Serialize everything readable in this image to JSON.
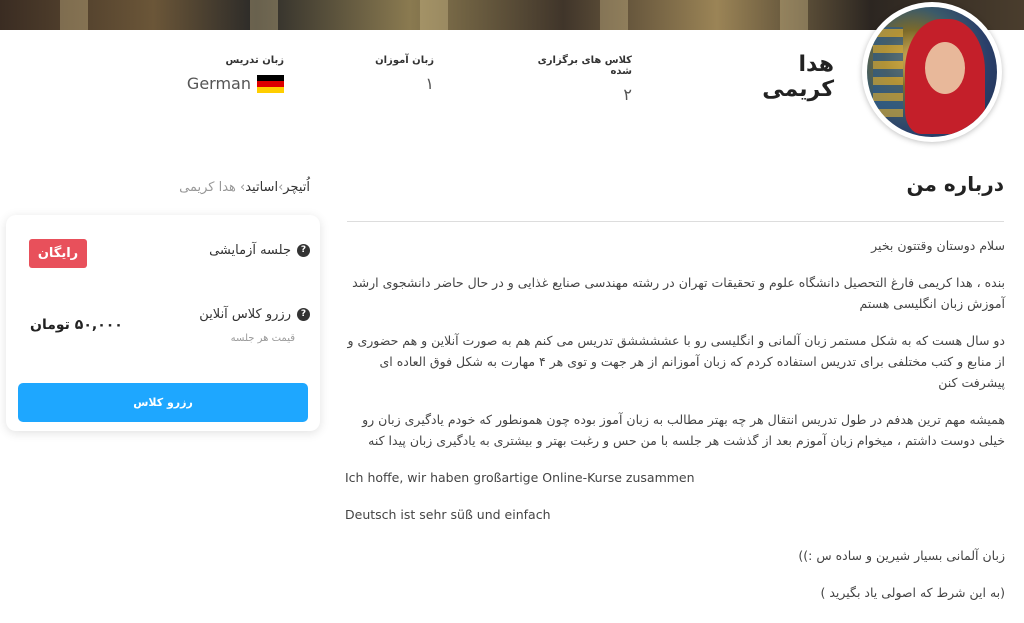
{
  "teacher": {
    "name": "هدا کریمی",
    "stats": {
      "classes_label": "کلاس های برگزاری شده",
      "classes_value": "۲",
      "students_label": "زبان آموزان",
      "students_value": "۱",
      "language_label": "زبان تدریس",
      "language_value": "German",
      "language_flag": "germany-flag-icon"
    }
  },
  "breadcrumb": {
    "home": "اُتیچر",
    "section": "اساتید",
    "current": "هدا کریمی",
    "separator": "›"
  },
  "about": {
    "title": "درباره من",
    "paragraphs": [
      "سلام دوستان وقتتون بخیر",
      "بنده ، هدا کریمی فارغ التحصیل دانشگاه علوم و تحقیقات تهران در رشته مهندسی صنایع غذایی و در حال حاضر دانشجوی ارشد آموزش زبان انگلیسی هستم",
      "دو سال هست که به شکل مستمر زبان آلمانی و انگلیسی رو با عششششق تدریس می کنم هم به صورت آنلاین و هم حضوری و از منابع و کتب مختلفی برای تدریس استفاده کردم که زبان آموزانم از هر جهت و توی هر ۴ مهارت به شکل فوق العاده ای پیشرفت کنن",
      "همیشه مهم ترین هدفم در طول تدریس انتقال هر چه بهتر مطالب به زبان آموز بوده چون همونطور که خودم یادگیری زبان رو خیلی دوست داشتم ، میخوام زبان آموزم بعد از گذشت هر جلسه با من حس و رغبت بهتر و بیشتری به یادگیری زبان پیدا کنه",
      "Ich hoffe, wir haben großartige Online-Kurse zusammen",
      "Deutsch ist sehr süß und einfach",
      "زبان آلمانی بسیار شیرین و ساده س :))",
      "(به این شرط که اصولی یاد بگیرید )"
    ]
  },
  "booking": {
    "trial_label": "جلسه آزمایشی",
    "trial_badge": "رایگان",
    "online_label": "رزرو کلاس آنلاین",
    "price_note": "قیمت هر جلسه",
    "price": "۵۰,۰۰۰ تومان",
    "button_label": "رزرو کلاس",
    "help_icon": "question-circle-icon",
    "badge_color": "#e8505b",
    "button_color": "#1ea7ff"
  }
}
